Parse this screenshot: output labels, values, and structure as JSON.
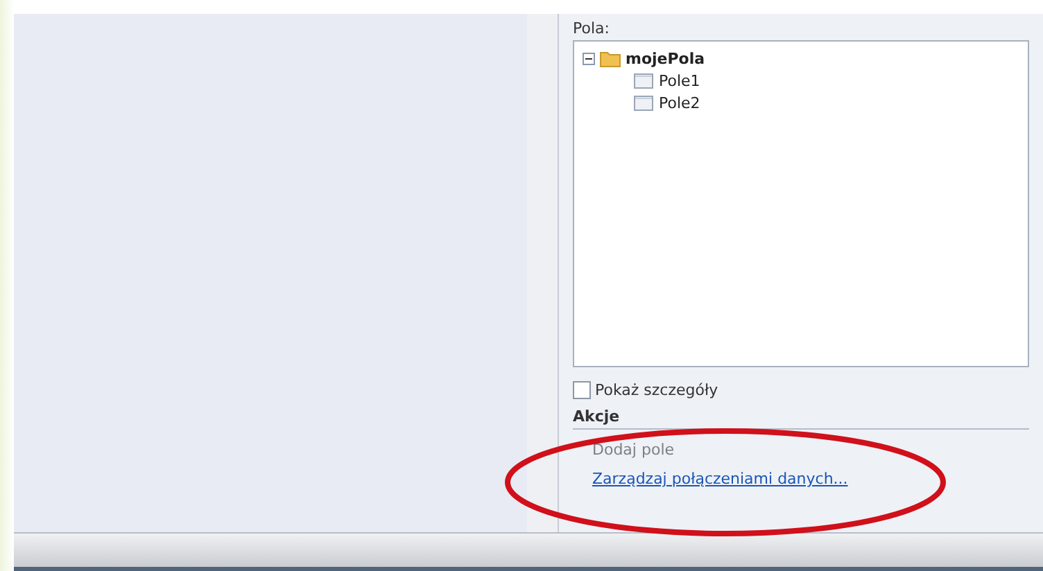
{
  "fields_panel": {
    "label": "Pola:",
    "tree": [
      {
        "label": "mojePola",
        "kind": "folder",
        "expanded": true,
        "children": [
          {
            "label": "Pole1",
            "kind": "field"
          },
          {
            "label": "Pole2",
            "kind": "field"
          }
        ]
      }
    ],
    "show_details": {
      "label": "Pokaż szczegóły",
      "checked": false
    }
  },
  "actions": {
    "heading": "Akcje",
    "items": [
      {
        "label": "Dodaj pole",
        "disabled": true
      },
      {
        "label": "Zarządzaj połączeniami danych...",
        "disabled": false
      }
    ]
  }
}
